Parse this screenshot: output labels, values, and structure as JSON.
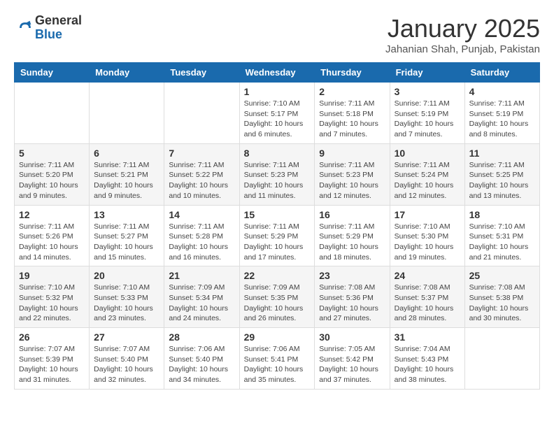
{
  "header": {
    "logo_general": "General",
    "logo_blue": "Blue",
    "title": "January 2025",
    "subtitle": "Jahanian Shah, Punjab, Pakistan"
  },
  "days_of_week": [
    "Sunday",
    "Monday",
    "Tuesday",
    "Wednesday",
    "Thursday",
    "Friday",
    "Saturday"
  ],
  "weeks": [
    [
      {
        "day": "",
        "info": ""
      },
      {
        "day": "",
        "info": ""
      },
      {
        "day": "",
        "info": ""
      },
      {
        "day": "1",
        "info": "Sunrise: 7:10 AM\nSunset: 5:17 PM\nDaylight: 10 hours\nand 6 minutes."
      },
      {
        "day": "2",
        "info": "Sunrise: 7:11 AM\nSunset: 5:18 PM\nDaylight: 10 hours\nand 7 minutes."
      },
      {
        "day": "3",
        "info": "Sunrise: 7:11 AM\nSunset: 5:19 PM\nDaylight: 10 hours\nand 7 minutes."
      },
      {
        "day": "4",
        "info": "Sunrise: 7:11 AM\nSunset: 5:19 PM\nDaylight: 10 hours\nand 8 minutes."
      }
    ],
    [
      {
        "day": "5",
        "info": "Sunrise: 7:11 AM\nSunset: 5:20 PM\nDaylight: 10 hours\nand 9 minutes."
      },
      {
        "day": "6",
        "info": "Sunrise: 7:11 AM\nSunset: 5:21 PM\nDaylight: 10 hours\nand 9 minutes."
      },
      {
        "day": "7",
        "info": "Sunrise: 7:11 AM\nSunset: 5:22 PM\nDaylight: 10 hours\nand 10 minutes."
      },
      {
        "day": "8",
        "info": "Sunrise: 7:11 AM\nSunset: 5:23 PM\nDaylight: 10 hours\nand 11 minutes."
      },
      {
        "day": "9",
        "info": "Sunrise: 7:11 AM\nSunset: 5:23 PM\nDaylight: 10 hours\nand 12 minutes."
      },
      {
        "day": "10",
        "info": "Sunrise: 7:11 AM\nSunset: 5:24 PM\nDaylight: 10 hours\nand 12 minutes."
      },
      {
        "day": "11",
        "info": "Sunrise: 7:11 AM\nSunset: 5:25 PM\nDaylight: 10 hours\nand 13 minutes."
      }
    ],
    [
      {
        "day": "12",
        "info": "Sunrise: 7:11 AM\nSunset: 5:26 PM\nDaylight: 10 hours\nand 14 minutes."
      },
      {
        "day": "13",
        "info": "Sunrise: 7:11 AM\nSunset: 5:27 PM\nDaylight: 10 hours\nand 15 minutes."
      },
      {
        "day": "14",
        "info": "Sunrise: 7:11 AM\nSunset: 5:28 PM\nDaylight: 10 hours\nand 16 minutes."
      },
      {
        "day": "15",
        "info": "Sunrise: 7:11 AM\nSunset: 5:29 PM\nDaylight: 10 hours\nand 17 minutes."
      },
      {
        "day": "16",
        "info": "Sunrise: 7:11 AM\nSunset: 5:29 PM\nDaylight: 10 hours\nand 18 minutes."
      },
      {
        "day": "17",
        "info": "Sunrise: 7:10 AM\nSunset: 5:30 PM\nDaylight: 10 hours\nand 19 minutes."
      },
      {
        "day": "18",
        "info": "Sunrise: 7:10 AM\nSunset: 5:31 PM\nDaylight: 10 hours\nand 21 minutes."
      }
    ],
    [
      {
        "day": "19",
        "info": "Sunrise: 7:10 AM\nSunset: 5:32 PM\nDaylight: 10 hours\nand 22 minutes."
      },
      {
        "day": "20",
        "info": "Sunrise: 7:10 AM\nSunset: 5:33 PM\nDaylight: 10 hours\nand 23 minutes."
      },
      {
        "day": "21",
        "info": "Sunrise: 7:09 AM\nSunset: 5:34 PM\nDaylight: 10 hours\nand 24 minutes."
      },
      {
        "day": "22",
        "info": "Sunrise: 7:09 AM\nSunset: 5:35 PM\nDaylight: 10 hours\nand 26 minutes."
      },
      {
        "day": "23",
        "info": "Sunrise: 7:08 AM\nSunset: 5:36 PM\nDaylight: 10 hours\nand 27 minutes."
      },
      {
        "day": "24",
        "info": "Sunrise: 7:08 AM\nSunset: 5:37 PM\nDaylight: 10 hours\nand 28 minutes."
      },
      {
        "day": "25",
        "info": "Sunrise: 7:08 AM\nSunset: 5:38 PM\nDaylight: 10 hours\nand 30 minutes."
      }
    ],
    [
      {
        "day": "26",
        "info": "Sunrise: 7:07 AM\nSunset: 5:39 PM\nDaylight: 10 hours\nand 31 minutes."
      },
      {
        "day": "27",
        "info": "Sunrise: 7:07 AM\nSunset: 5:40 PM\nDaylight: 10 hours\nand 32 minutes."
      },
      {
        "day": "28",
        "info": "Sunrise: 7:06 AM\nSunset: 5:40 PM\nDaylight: 10 hours\nand 34 minutes."
      },
      {
        "day": "29",
        "info": "Sunrise: 7:06 AM\nSunset: 5:41 PM\nDaylight: 10 hours\nand 35 minutes."
      },
      {
        "day": "30",
        "info": "Sunrise: 7:05 AM\nSunset: 5:42 PM\nDaylight: 10 hours\nand 37 minutes."
      },
      {
        "day": "31",
        "info": "Sunrise: 7:04 AM\nSunset: 5:43 PM\nDaylight: 10 hours\nand 38 minutes."
      },
      {
        "day": "",
        "info": ""
      }
    ]
  ]
}
